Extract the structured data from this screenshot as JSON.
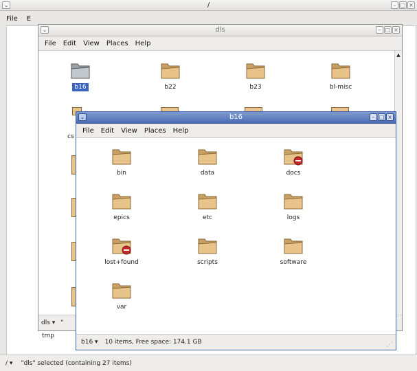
{
  "back_window": {
    "title": "/",
    "menu": [
      "File",
      "E"
    ],
    "folder_label": "tmp",
    "status": "\"dls\" selected (containing 27 items)",
    "location": "/"
  },
  "mid_window": {
    "title": "dls",
    "menu": [
      "File",
      "Edit",
      "View",
      "Places",
      "Help"
    ],
    "folders": [
      {
        "name": "b16",
        "selected": true
      },
      {
        "name": "b22"
      },
      {
        "name": "b23"
      },
      {
        "name": "bl-misc"
      }
    ],
    "partial_label": "cs",
    "location": "dls",
    "status_partial": "\""
  },
  "front_window": {
    "title": "b16",
    "menu": [
      "File",
      "Edit",
      "View",
      "Places",
      "Help"
    ],
    "folders": [
      {
        "name": "bin"
      },
      {
        "name": "data"
      },
      {
        "name": "docs",
        "locked": true
      },
      {
        "name": "epics"
      },
      {
        "name": "etc"
      },
      {
        "name": "logs"
      },
      {
        "name": "lost+found",
        "locked": true
      },
      {
        "name": "scripts"
      },
      {
        "name": "software"
      },
      {
        "name": "var"
      }
    ],
    "location": "b16",
    "status": "10 items, Free space: 174.1 GB"
  },
  "colors": {
    "folder": "#e9c48a",
    "selection": "#3d64c2",
    "emblem": "#c0282a",
    "active_title": "#5a78bc"
  },
  "icons": {
    "folder": "folder-icon",
    "emblem": "no-access-emblem-icon"
  }
}
